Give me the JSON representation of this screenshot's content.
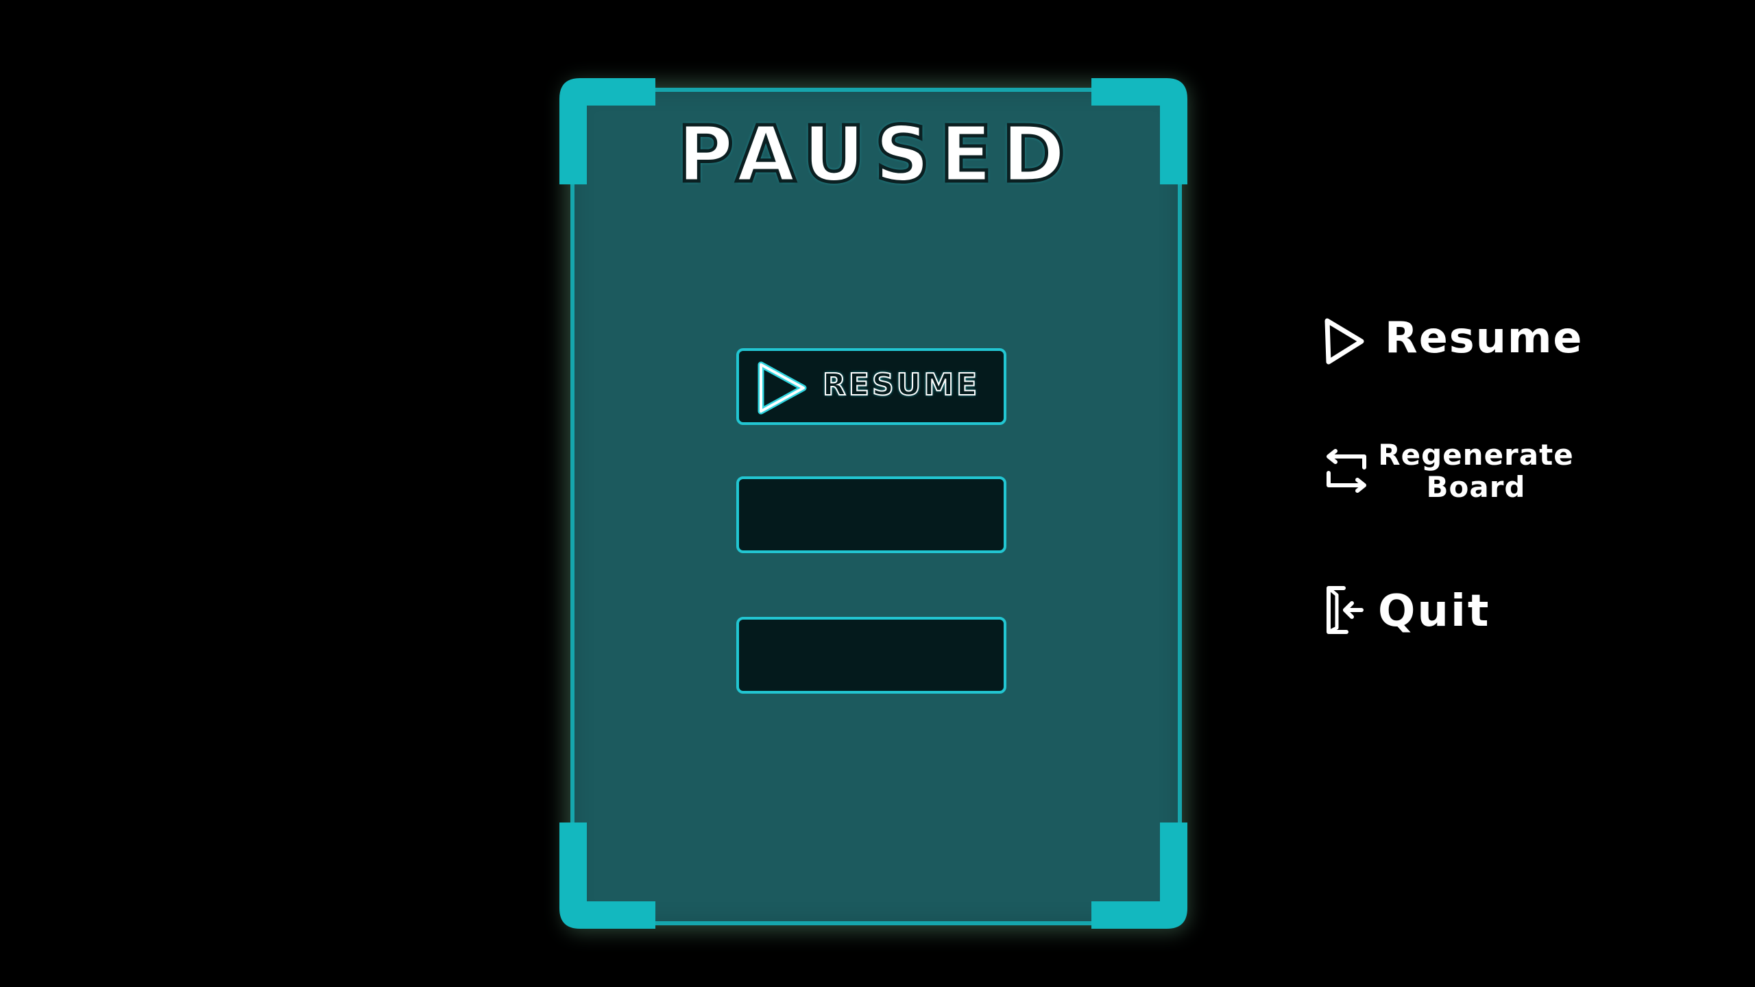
{
  "pause_menu": {
    "title": "PAUSED",
    "buttons": [
      {
        "label": "RESUME",
        "icon": "play-icon"
      },
      {
        "label": "",
        "icon": ""
      },
      {
        "label": "",
        "icon": ""
      }
    ]
  },
  "sketch_notes": {
    "resume": {
      "label": "Resume",
      "icon": "play-outline-icon"
    },
    "regenerate": {
      "line1": "Regenerate",
      "line2": "Board",
      "icon": "swap-arrows-icon"
    },
    "quit": {
      "label": "Quit",
      "icon": "exit-door-icon"
    }
  },
  "colors": {
    "background": "#000000",
    "panel_fill": "#1c5a5e",
    "panel_border": "#16a6ad",
    "button_fill": "#041a1c",
    "button_border": "#22c6d2",
    "glow": "#2fd6e0"
  }
}
